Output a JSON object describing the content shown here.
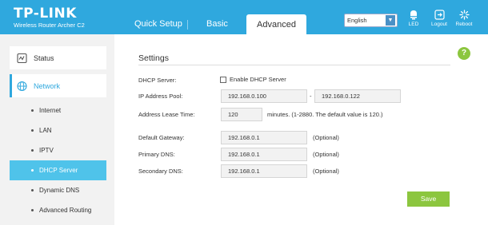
{
  "brand": {
    "logo": "TP-LINK",
    "model": "Wireless Router Archer C2"
  },
  "tabs": [
    {
      "label": "Quick Setup"
    },
    {
      "label": "Basic"
    },
    {
      "label": "Advanced",
      "active": true
    }
  ],
  "header": {
    "language": "English",
    "led_label": "LED",
    "logout_label": "Logout",
    "reboot_label": "Reboot"
  },
  "sidebar": {
    "status_label": "Status",
    "network_label": "Network",
    "items": [
      {
        "label": "Internet"
      },
      {
        "label": "LAN"
      },
      {
        "label": "IPTV"
      },
      {
        "label": "DHCP Server",
        "active": true
      },
      {
        "label": "Dynamic DNS"
      },
      {
        "label": "Advanced Routing"
      }
    ]
  },
  "settings": {
    "title": "Settings",
    "help": "?",
    "dhcp_server_label": "DHCP Server:",
    "enable_label": "Enable DHCP Server",
    "enable_checked": false,
    "pool_label": "IP Address Pool:",
    "pool_start": "192.168.0.100",
    "pool_dash": "-",
    "pool_end": "192.168.0.122",
    "lease_label": "Address Lease Time:",
    "lease_value": "120",
    "lease_hint": "minutes. (1-2880. The default value is 120.)",
    "gateway_label": "Default Gateway:",
    "gateway_value": "192.168.0.1",
    "primary_dns_label": "Primary DNS:",
    "primary_dns_value": "192.168.0.1",
    "secondary_dns_label": "Secondary DNS:",
    "secondary_dns_value": "192.168.0.1",
    "optional": "(Optional)",
    "save_label": "Save"
  },
  "colors": {
    "header": "#2fa8de",
    "active_sub": "#4fc3ea",
    "save": "#8cc63f"
  }
}
